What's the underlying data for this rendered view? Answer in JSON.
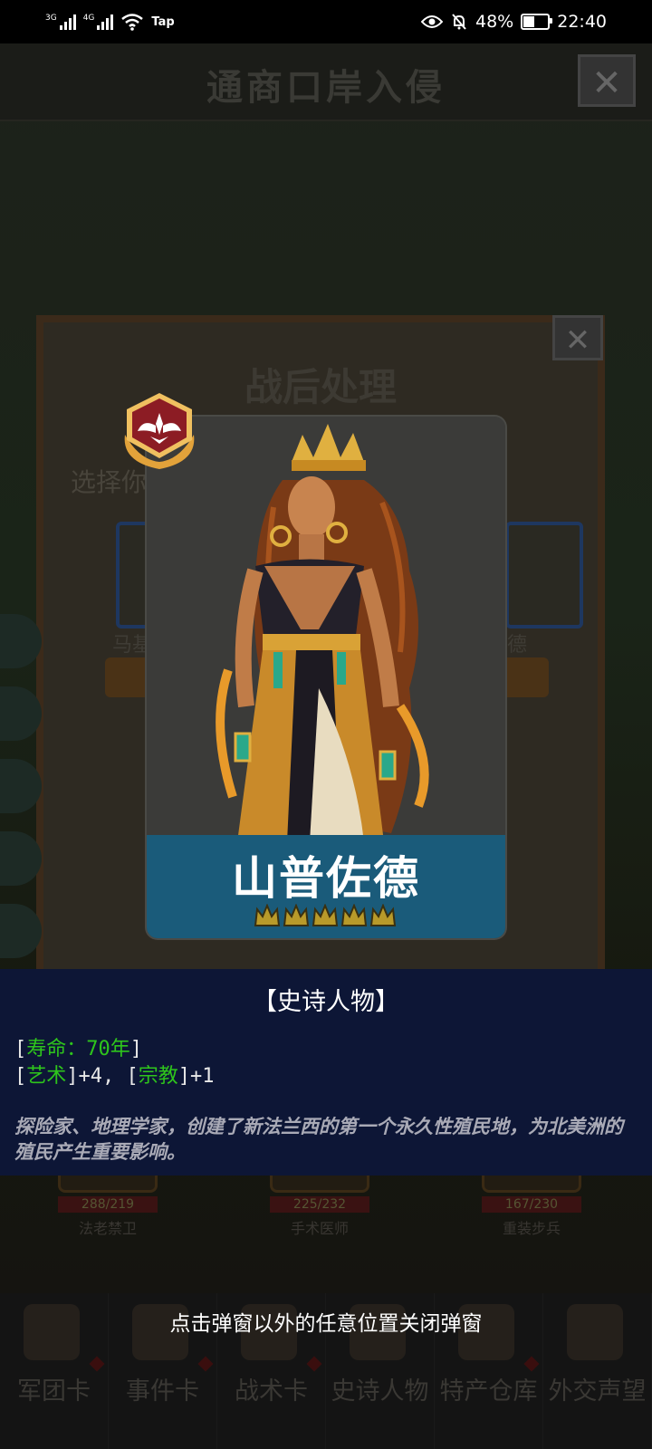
{
  "status_bar": {
    "net1": "3G",
    "net2": "4G",
    "app": "Tap",
    "battery": "48%",
    "battery_level": 0.48,
    "time": "22:40"
  },
  "background": {
    "title": "通商口岸入侵",
    "panel_title": "战后处理",
    "panel_subtitle": "选择你",
    "slot_left_name": "马基",
    "slot_right_name": "德",
    "unit_cards": [
      {
        "hp": "288/219",
        "name": "法老禁卫"
      },
      {
        "hp": "225/232",
        "name": "手术医师"
      },
      {
        "hp": "167/230",
        "name": "重装步兵"
      }
    ],
    "tabs": [
      "军团卡",
      "事件卡",
      "战术卡",
      "史诗人物",
      "特产仓库",
      "外交声望"
    ]
  },
  "card": {
    "name": "山普佐德",
    "crowns": 5
  },
  "info": {
    "category": "【史诗人物】",
    "lifespan_label": "寿命：70年",
    "stat1_label": "艺术",
    "stat1_value": "+4",
    "stat2_label": "宗教",
    "stat2_value": "+1",
    "description": "探险家、地理学家，创建了新法兰西的第一个永久性殖民地，为北美洲的殖民产生重要影响。"
  },
  "hint": "点击弹窗以外的任意位置关闭弹窗",
  "colors": {
    "name_bar": "#1a5b7a",
    "info_bg": "#0d1636",
    "stat_green": "#2ec51c",
    "badge_red": "#8c1c24",
    "badge_gold": "#e2a23a"
  }
}
